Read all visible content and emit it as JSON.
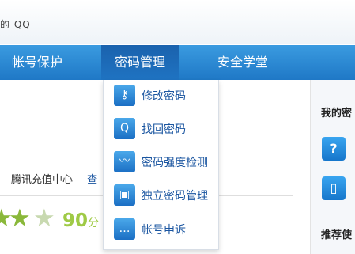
{
  "brand": {
    "text": "的 QQ"
  },
  "nav": {
    "items": [
      {
        "label": "帐号保护"
      },
      {
        "label": "密码管理"
      },
      {
        "label": "安全学堂"
      }
    ]
  },
  "dropdown": {
    "items": [
      {
        "label": "修改密码",
        "icon": "key-icon"
      },
      {
        "label": "找回密码",
        "icon": "find-password-icon"
      },
      {
        "label": "密码强度检测",
        "icon": "pulse-icon"
      },
      {
        "label": "独立密码管理",
        "icon": "briefcase-icon"
      },
      {
        "label": "帐号申诉",
        "icon": "chat-bubble-icon"
      }
    ]
  },
  "links": {
    "recharge": "腾讯充值中心",
    "query": "查"
  },
  "score": {
    "value": "90",
    "unit": "分",
    "stars_filled": 2.5
  },
  "right_panel": {
    "title1": "我的密",
    "title2": "推荐使",
    "icon_labels": [
      "?",
      "▯"
    ]
  },
  "colors": {
    "nav_bg": "#2a88d6",
    "nav_active": "#1a62ad",
    "menu_text": "#1a55a0",
    "score_green": "#9fca46"
  }
}
